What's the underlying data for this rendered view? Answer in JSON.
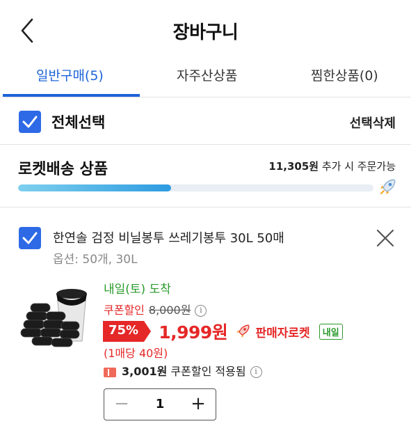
{
  "header": {
    "title": "장바구니",
    "back_icon": "chevron-left-icon"
  },
  "tabs": [
    {
      "label": "일반구매(5)",
      "active": true
    },
    {
      "label": "자주산상품",
      "active": false
    },
    {
      "label": "찜한상품(0)",
      "active": false
    }
  ],
  "select_all": {
    "label": "전체선택",
    "checked": true,
    "delete_label": "선택삭제"
  },
  "rocket": {
    "title": "로켓배송 상품",
    "remaining_amount": "11,305원",
    "remaining_text": " 추가 시 주문가능",
    "progress_fraction": 0.43
  },
  "item": {
    "checked": true,
    "name": "한연솔 검정 비닐봉투 쓰레기봉투 30L 50매",
    "option": "옵션: 50개, 30L",
    "arrival": "내일(토) 도착",
    "coupon_label": "쿠폰할인",
    "original_price": "8,000원",
    "discount_rate": "75%",
    "price": "1,999원",
    "seller_label": "판매자로켓",
    "tomorrow_badge": "내일",
    "unit_price": "(1매당 40원)",
    "coupon_applied_amount": "3,001원",
    "coupon_applied_text": " 쿠폰할인 적용됨",
    "quantity": "1"
  },
  "colors": {
    "accent": "#1d63d8",
    "checkbox": "#2e6ae6",
    "price_red": "#e52727",
    "arrival_green": "#2a9a2a"
  }
}
